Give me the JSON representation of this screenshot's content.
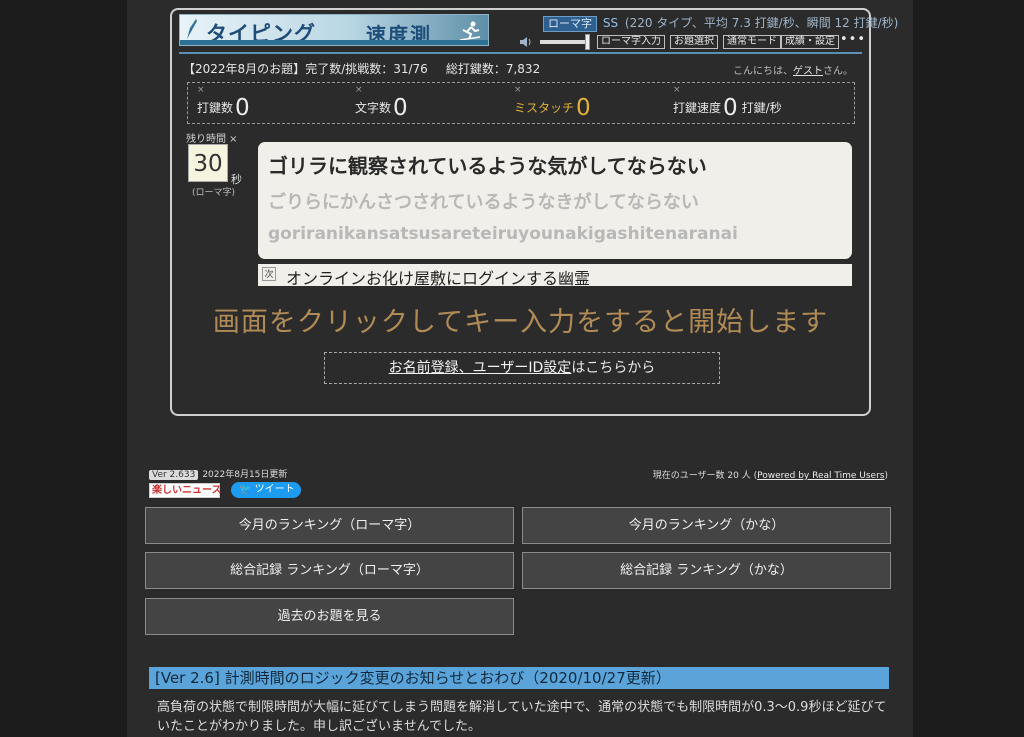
{
  "header": {
    "logo_text_1": "タイピング",
    "logo_text_2": "速度測",
    "mode_badge": "ローマ字",
    "mode_rank": "SS",
    "mode_stats": "(220 タイプ、平均 7.3 打鍵/秒、瞬間 12 打鍵/秒)",
    "buttons": [
      "ローマ字入力",
      "お題選択",
      "通常モード",
      "成績・設定"
    ],
    "more": "•••"
  },
  "info": {
    "theme": "【2022年8月のお題】",
    "completed_label": "完了数/挑戦数：",
    "completed_value": "31/76",
    "total_keys_label": "総打鍵数：",
    "total_keys_value": "7,832",
    "greeting_prefix": "こんにちは、",
    "greeting_name": "ゲスト",
    "greeting_suffix": "さん。"
  },
  "stats": {
    "x_mark": "×",
    "keys_label": "打鍵数",
    "keys_value": "0",
    "chars_label": "文字数",
    "chars_value": "0",
    "miss_label": "ミスタッチ",
    "miss_value": "0",
    "speed_label": "打鍵速度",
    "speed_value": "0",
    "speed_unit": "打鍵/秒"
  },
  "timer": {
    "label": "残り時間 ×",
    "value": "30",
    "unit": "秒",
    "mode": "(ローマ字)"
  },
  "question": {
    "main": "ゴリラに観察されているような気がしてならない",
    "kana": "ごりらにかんさつされているようなきがしてならない",
    "romaji": "goriranikansatsusareteiruyounakigashitenaranai"
  },
  "next": {
    "tag": "次",
    "text": "オンラインお化け屋敷にログインする幽霊"
  },
  "start_message": "画面をクリックしてキー入力をすると開始します",
  "register": {
    "link": "お名前登録、ユーザーID設定",
    "suffix": "はこちらから"
  },
  "footer": {
    "version": "Ver 2.633",
    "updated": "2022年8月15日更新",
    "users_prefix": "現在のユーザー数 20 人 (",
    "users_link": "Powered by Real Time Users",
    "users_suffix": ")",
    "rakushi": "楽しいニュース",
    "tweet": "ツイート"
  },
  "ranking_buttons": [
    "今月のランキング（ローマ字）",
    "今月のランキング（かな）",
    "総合記録 ランキング（ローマ字）",
    "総合記録 ランキング（かな）",
    "過去のお題を見る"
  ],
  "notice": {
    "title": "[Ver 2.6] 計測時間のロジック変更のお知らせとおわび（2020/10/27更新）",
    "body": "高負荷の状態で制限時間が大幅に延びてしまう問題を解消していた途中で、通常の状態でも制限時間が0.3～0.9秒ほど延びていたことがわかりました。申し訳ございませんでした。"
  }
}
